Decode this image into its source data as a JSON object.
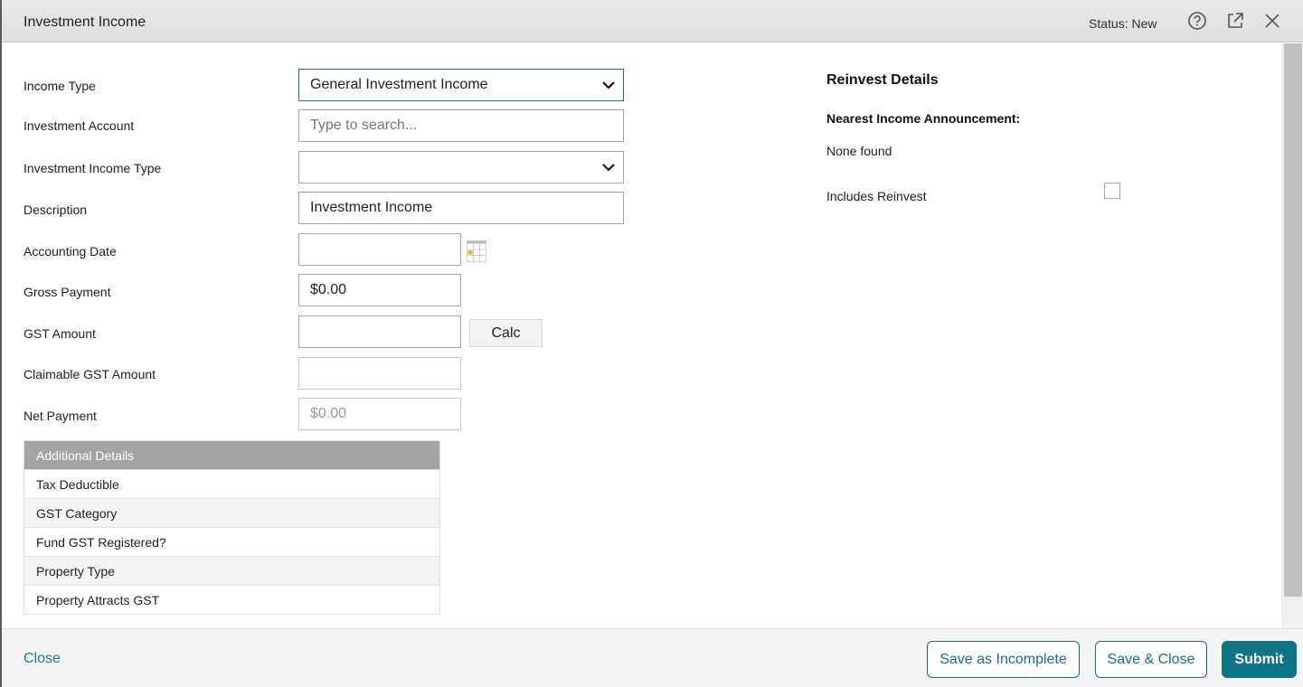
{
  "header": {
    "title": "Investment Income",
    "status": "Status: New",
    "icons": [
      "help-icon",
      "popout-icon",
      "close-icon"
    ]
  },
  "form": {
    "income_type": {
      "label": "Income Type",
      "value": "General Investment Income"
    },
    "investment_account": {
      "label": "Investment Account",
      "value": "",
      "placeholder": "Type to search..."
    },
    "investment_income_type": {
      "label": "Investment Income Type",
      "value": ""
    },
    "description": {
      "label": "Description",
      "value": "Investment Income"
    },
    "accounting_date": {
      "label": "Accounting Date",
      "value": ""
    },
    "gross_payment": {
      "label": "Gross Payment",
      "value": "$0.00"
    },
    "gst_amount": {
      "label": "GST Amount",
      "value": "",
      "calc_label": "Calc"
    },
    "claimable_gst_amount": {
      "label": "Claimable GST Amount",
      "value": ""
    },
    "net_payment": {
      "label": "Net Payment",
      "value": "$0.00"
    }
  },
  "additional_details": {
    "title": "Additional Details",
    "rows": [
      "Tax Deductible",
      "GST Category",
      "Fund GST Registered?",
      "Property Type",
      "Property Attracts GST"
    ]
  },
  "reinvest": {
    "title": "Reinvest Details",
    "nearest_label": "Nearest Income Announcement:",
    "nearest_value": "None found",
    "includes_label": "Includes Reinvest",
    "includes_checked": false
  },
  "footer": {
    "close": "Close",
    "save_incomplete": "Save as Incomplete",
    "save_close": "Save & Close",
    "submit": "Submit"
  },
  "colors": {
    "accent": "#0f7485",
    "link": "#1a7a8c",
    "header_bg": "#e4e4e4"
  }
}
